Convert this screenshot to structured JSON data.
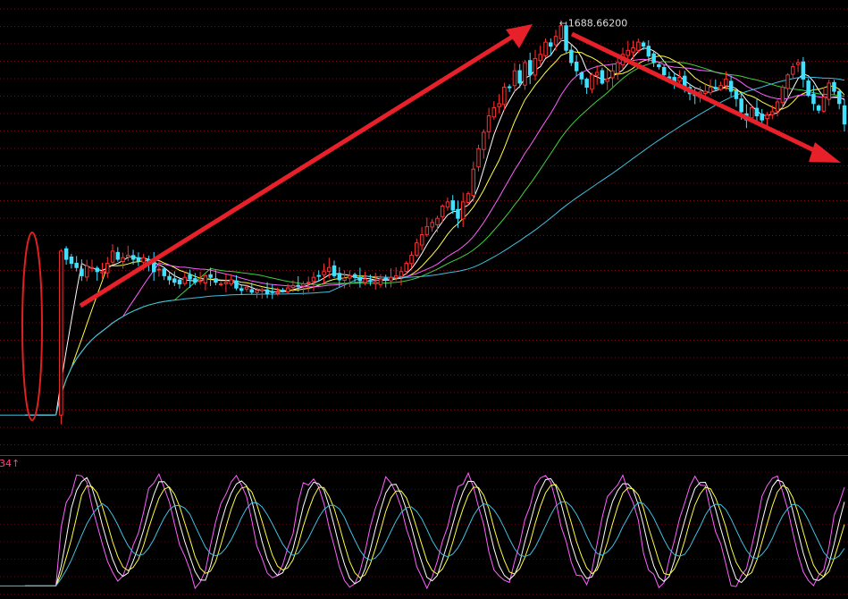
{
  "main_panel": {
    "peak_label": "1688.66200",
    "peak_marker": "←",
    "period_count": 160,
    "peak_index": 104,
    "annotations": {
      "uptrend_arrow": "red-arrow-up",
      "downtrend_arrow": "red-arrow-down",
      "start_ellipse": "red-ellipse"
    },
    "ma_colors": [
      "#ffffff",
      "#ffff40",
      "#ff60ff",
      "#40d040",
      "#40c0e0"
    ],
    "candle_colors": {
      "up": "#ff3030",
      "down": "#40e0ff"
    }
  },
  "indicator_panel": {
    "label_text": "34",
    "label_arrow": "↑",
    "label_color": "#ff4080",
    "line_colors": [
      "#ff60ff",
      "#ffffff",
      "#ffff40",
      "#40c0e0"
    ]
  },
  "chart_data": {
    "type": "candlestick",
    "title": "",
    "series": [
      {
        "name": "",
        "values": [
          1210,
          1210,
          1210,
          1210,
          1210,
          1210,
          1212,
          1410,
          1400,
          1395,
          1390,
          1380,
          1392,
          1390,
          1385,
          1385,
          1395,
          1410,
          1400,
          1402,
          1405,
          1400,
          1398,
          1402,
          1395,
          1385,
          1388,
          1380,
          1375,
          1372,
          1370,
          1378,
          1376,
          1372,
          1374,
          1380,
          1378,
          1372,
          1370,
          1372,
          1375,
          1365,
          1362,
          1366,
          1360,
          1362,
          1363,
          1358,
          1360,
          1360,
          1362,
          1365,
          1368,
          1368,
          1370,
          1372,
          1378,
          1380,
          1385,
          1390,
          1380,
          1375,
          1377,
          1380,
          1378,
          1374,
          1376,
          1373,
          1372,
          1376,
          1375,
          1378,
          1380,
          1385,
          1395,
          1405,
          1420,
          1430,
          1440,
          1445,
          1450,
          1465,
          1470,
          1460,
          1450,
          1470,
          1480,
          1510,
          1535,
          1555,
          1575,
          1585,
          1590,
          1610,
          1610,
          1630,
          1615,
          1640,
          1625,
          1645,
          1650,
          1665,
          1660,
          1672,
          1685,
          1655,
          1640,
          1630,
          1620,
          1610,
          1625,
          1628,
          1615,
          1620,
          1630,
          1640,
          1650,
          1655,
          1658,
          1665,
          1660,
          1648,
          1640,
          1635,
          1625,
          1620,
          1615,
          1622,
          1608,
          1602,
          1600,
          1604,
          1605,
          1610,
          1608,
          1612,
          1620,
          1605,
          1596,
          1580,
          1570,
          1585,
          1575,
          1570,
          1576,
          1580,
          1592,
          1610,
          1625,
          1635,
          1640,
          1620,
          1600,
          1590,
          1582,
          1598,
          1615,
          1605,
          1590,
          1565
        ]
      }
    ],
    "peak": {
      "label": "1688.66200",
      "value": 1688.662
    }
  }
}
